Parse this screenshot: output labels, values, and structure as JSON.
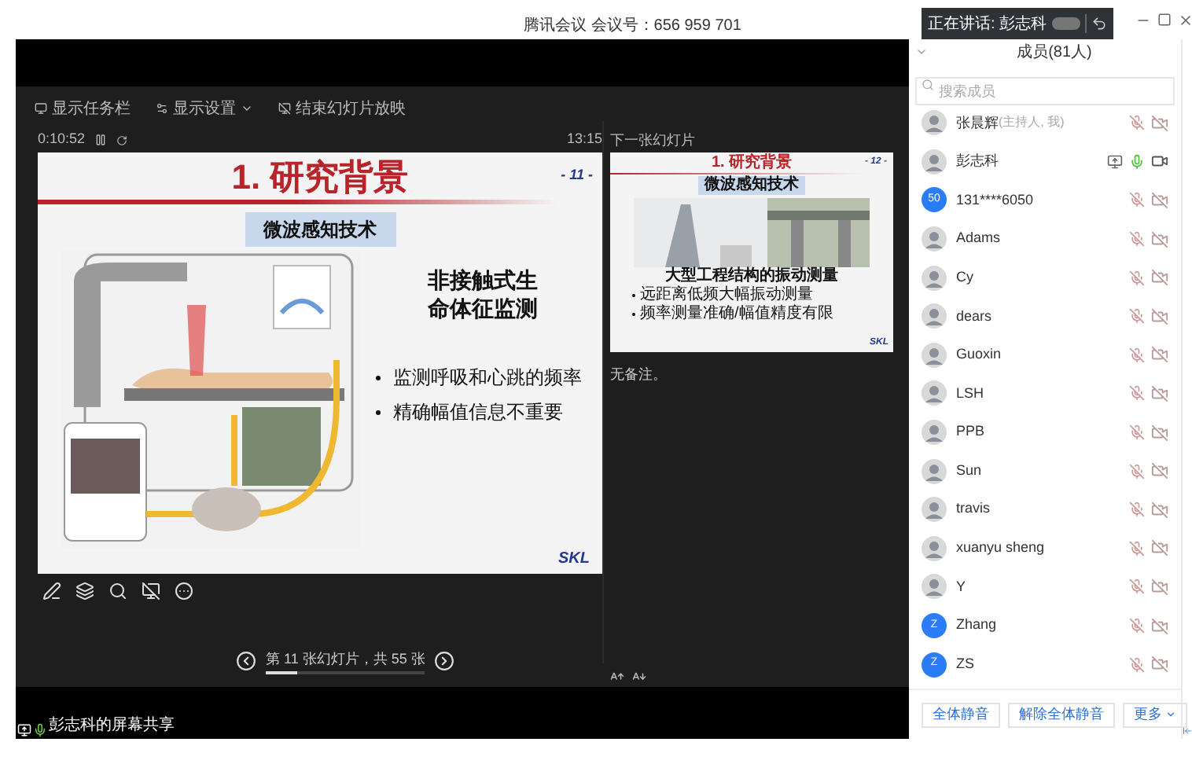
{
  "window": {
    "title": "腾讯会议 会议号：656 959 701"
  },
  "speaking_toast": {
    "label": "正在讲话: 彭志科"
  },
  "presenter": {
    "toolbar": [
      {
        "label": "显示任务栏",
        "has_caret": false
      },
      {
        "label": "显示设置",
        "has_caret": true
      },
      {
        "label": "结束幻灯片放映",
        "has_caret": false
      }
    ],
    "elapsed": "0:10:52",
    "clock": "13:15",
    "slide": {
      "title": "1. 研究背景",
      "page": "- 11 -",
      "subtitle": "微波感知技术",
      "headline_lines": [
        "非接触式生",
        "命体征监测"
      ],
      "bullets": [
        "监测呼吸和心跳的频率",
        "精确幅值信息不重要"
      ],
      "logo": "SKL"
    },
    "next_label": "下一张幻灯片",
    "next_slide": {
      "title": "1. 研究背景",
      "page": "- 12 -",
      "subtitle": "微波感知技术",
      "caption": "大型工程结构的振动测量",
      "bullets": [
        "远距离低频大幅振动测量",
        "频率测量准确/幅值精度有限"
      ],
      "logo": "SKL"
    },
    "notes": "无备注。",
    "navigator": {
      "label": "第 11 张幻灯片，共 55 张",
      "level": 0.2
    }
  },
  "share_label": "彭志科的屏幕共享",
  "members": {
    "title": "成员(81人)",
    "search": {
      "placeholder": "搜索成员"
    },
    "list": [
      {
        "name": "张晨辉",
        "note": "(主持人, 我)",
        "mic_on": false,
        "camera_on": false,
        "sharing": false
      },
      {
        "name": "彭志科",
        "mic_on": true,
        "camera_on": true,
        "sharing": true
      },
      {
        "name": "131****6050",
        "avatar": {
          "kind": "initials",
          "text": "50"
        },
        "mic_on": false,
        "camera_on": false,
        "sharing": false
      },
      {
        "name": "Adams",
        "mic_on": false,
        "camera_on": false,
        "sharing": false
      },
      {
        "name": "Cy",
        "mic_on": false,
        "camera_on": false,
        "sharing": false
      },
      {
        "name": "dears",
        "mic_on": false,
        "camera_on": false,
        "sharing": false
      },
      {
        "name": "Guoxin",
        "mic_on": false,
        "camera_on": false,
        "sharing": false
      },
      {
        "name": "LSH",
        "mic_on": false,
        "camera_on": false,
        "sharing": false
      },
      {
        "name": "PPB",
        "mic_on": false,
        "camera_on": false,
        "sharing": false
      },
      {
        "name": "Sun",
        "mic_on": false,
        "camera_on": false,
        "sharing": false
      },
      {
        "name": "travis",
        "mic_on": false,
        "camera_on": false,
        "sharing": false
      },
      {
        "name": "xuanyu sheng",
        "mic_on": false,
        "camera_on": false,
        "sharing": false
      },
      {
        "name": "Y",
        "mic_on": false,
        "camera_on": false,
        "sharing": false
      },
      {
        "name": "Zhang",
        "avatar": {
          "kind": "initials",
          "text": "Z"
        },
        "mic_on": false,
        "camera_on": false,
        "sharing": false
      },
      {
        "name": "ZS",
        "avatar": {
          "kind": "initials",
          "text": "Z"
        },
        "mic_on": false,
        "camera_on": false,
        "sharing": false
      }
    ],
    "buttons": [
      "全体静音",
      "解除全体静音"
    ],
    "more": "更多"
  }
}
